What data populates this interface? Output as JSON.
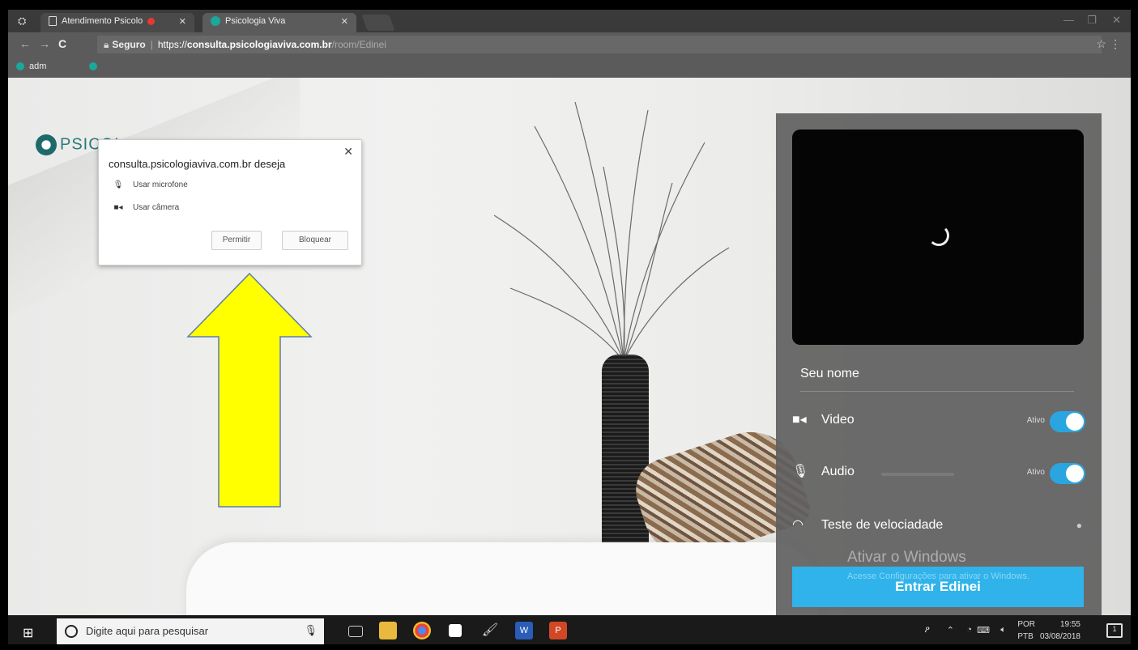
{
  "browser": {
    "tabs": [
      {
        "label": "Atendimento Psicolo",
        "active": false
      },
      {
        "label": "Psicologia Viva",
        "active": true
      }
    ],
    "address": {
      "secure_label": "Seguro",
      "scheme": "https://",
      "host": "consulta.psicologiaviva.com.br",
      "path": "/room/Edinei"
    },
    "bookmarks": [
      "adm"
    ]
  },
  "permission_popup": {
    "title": "consulta.psicologiaviva.com.br deseja",
    "items": [
      {
        "icon": "microphone-icon",
        "label": "Usar microfone"
      },
      {
        "icon": "camera-icon",
        "label": "Usar câmera"
      }
    ],
    "allow_label": "Permitir",
    "block_label": "Bloquear"
  },
  "page": {
    "logo_text": "PSICOL"
  },
  "panel": {
    "name_placeholder": "Seu nome",
    "video_label": "Video",
    "video_state": "Ativo",
    "audio_label": "Audio",
    "audio_state": "Ativo",
    "speed_label": "Teste de velociadade",
    "enter_label": "Entrar Edinei"
  },
  "watermark": {
    "line1": "Ativar o Windows",
    "line2": "Acesse Configurações para ativar o Windows."
  },
  "taskbar": {
    "search_placeholder": "Digite aqui para pesquisar",
    "lang_top": "POR",
    "lang_bottom": "PTB",
    "time": "19:55",
    "date": "03/08/2018",
    "notifications": "1"
  },
  "colors": {
    "accent": "#2fb3ea",
    "arrow_fill": "#ffff00",
    "panel_bg": "#606060"
  }
}
